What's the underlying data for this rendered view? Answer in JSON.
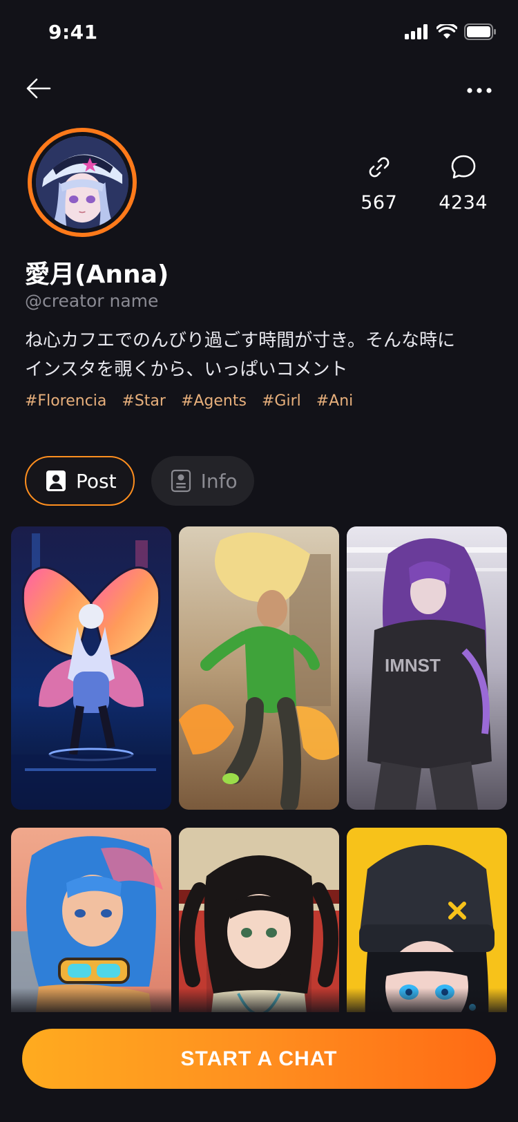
{
  "status_bar": {
    "time": "9:41"
  },
  "icons": {
    "back": "arrow-left-icon",
    "more": "more-horizontal-icon",
    "link": "link-icon",
    "chat": "chat-bubble-icon",
    "post_tab": "user-portrait-icon",
    "info_tab": "contact-card-icon",
    "signal": "signal-icon",
    "wifi": "wifi-icon",
    "battery": "battery-icon"
  },
  "profile": {
    "name": "愛月(Anna)",
    "username": "@creator name",
    "bio": "ね心カフエでのんびり過ごす時間が寸き。そんな時にインスタを覗くから、いっぱいコメント",
    "stats": [
      {
        "icon": "link-icon",
        "value": "567"
      },
      {
        "icon": "chat-bubble-icon",
        "value": "4234"
      }
    ],
    "tags": [
      "#Florencia",
      "#Star",
      "#Agents",
      "#Girl",
      "#Ani"
    ]
  },
  "tabs": [
    {
      "label": "Post",
      "active": true
    },
    {
      "label": "Info",
      "active": false
    }
  ],
  "posts": [
    {
      "theme": "butterfly-neon"
    },
    {
      "theme": "green-runner"
    },
    {
      "theme": "purple-hair-street"
    },
    {
      "theme": "blue-hair-goggles"
    },
    {
      "theme": "twin-tails-train"
    },
    {
      "theme": "beanie-yellow"
    }
  ],
  "cta": {
    "label": "START A CHAT"
  },
  "colors": {
    "background": "#121218",
    "accent": "#ff8f1f",
    "tag": "#e8b07c",
    "muted": "#8a8a93"
  }
}
